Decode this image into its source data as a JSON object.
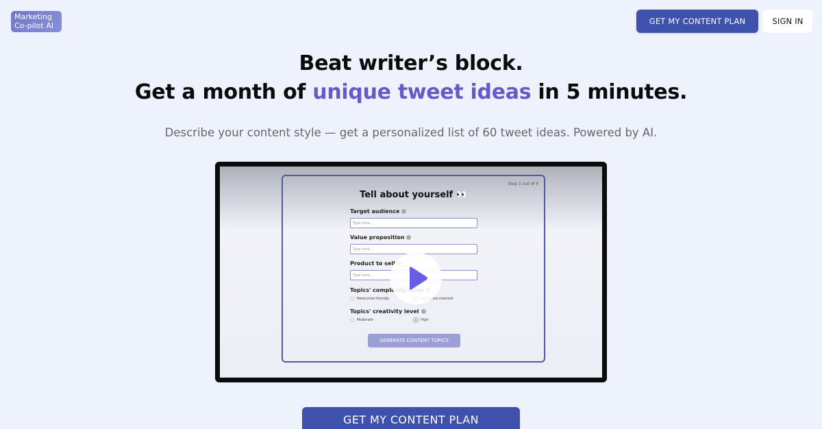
{
  "logo": {
    "line1": "Marketing",
    "line2": "Co-pilot AI"
  },
  "nav": {
    "cta_label": "GET MY CONTENT PLAN",
    "signin_label": "SIGN IN"
  },
  "hero": {
    "headline_line1": "Beat writer’s block.",
    "headline_prefix": "Get a month of ",
    "headline_accent": "unique tweet ideas",
    "headline_suffix": " in 5 minutes.",
    "subtitle": "Describe your content style — get a personalized list of 60 tweet ideas. Powered by AI."
  },
  "video": {
    "step": "Step 1 out of 4",
    "title": "Tell about yourself 👀",
    "fields": [
      {
        "label": "Target audience",
        "placeholder": "Type here..."
      },
      {
        "label": "Value proposition",
        "placeholder": "Type here..."
      },
      {
        "label": "Product to sell",
        "placeholder": "Type here..."
      }
    ],
    "complexity": {
      "label": "Topics' complexity level",
      "option1": "Newcomer-friendly",
      "option2": "Advanced-oriented"
    },
    "creativity": {
      "label": "Topics' creativity level",
      "option1": "Moderate",
      "option2": "High"
    },
    "generate_label": "GENERATE CONTENT TOPICS",
    "play_icon": "play-icon"
  },
  "bottom": {
    "cta_label": "GET MY CONTENT PLAN"
  },
  "colors": {
    "primary": "#3d51ad",
    "accent": "#6a59c4",
    "background": "#eef2fd",
    "play": "#6b5ce7"
  }
}
